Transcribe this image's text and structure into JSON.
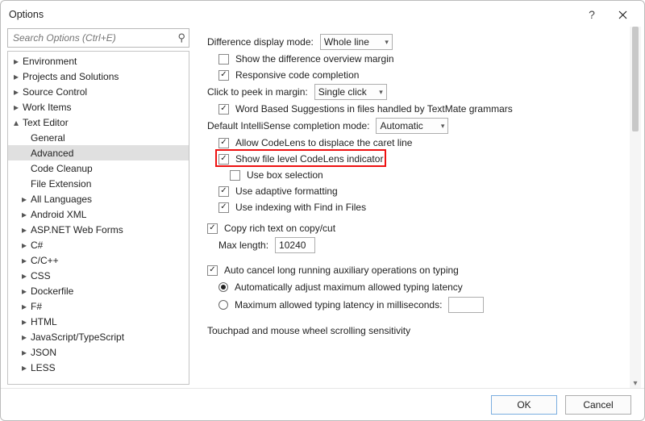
{
  "window": {
    "title": "Options"
  },
  "search": {
    "placeholder": "Search Options (Ctrl+E)"
  },
  "tree": {
    "items": [
      {
        "label": "Environment",
        "expandable": true,
        "expanded": false,
        "depth": 0
      },
      {
        "label": "Projects and Solutions",
        "expandable": true,
        "expanded": false,
        "depth": 0
      },
      {
        "label": "Source Control",
        "expandable": true,
        "expanded": false,
        "depth": 0
      },
      {
        "label": "Work Items",
        "expandable": true,
        "expanded": false,
        "depth": 0
      },
      {
        "label": "Text Editor",
        "expandable": true,
        "expanded": true,
        "depth": 0
      },
      {
        "label": "General",
        "expandable": false,
        "depth": 1
      },
      {
        "label": "Advanced",
        "expandable": false,
        "depth": 1,
        "selected": true
      },
      {
        "label": "Code Cleanup",
        "expandable": false,
        "depth": 1
      },
      {
        "label": "File Extension",
        "expandable": false,
        "depth": 1
      },
      {
        "label": "All Languages",
        "expandable": true,
        "expanded": false,
        "depth": 1
      },
      {
        "label": "Android XML",
        "expandable": true,
        "expanded": false,
        "depth": 1
      },
      {
        "label": "ASP.NET Web Forms",
        "expandable": true,
        "expanded": false,
        "depth": 1
      },
      {
        "label": "C#",
        "expandable": true,
        "expanded": false,
        "depth": 1
      },
      {
        "label": "C/C++",
        "expandable": true,
        "expanded": false,
        "depth": 1
      },
      {
        "label": "CSS",
        "expandable": true,
        "expanded": false,
        "depth": 1
      },
      {
        "label": "Dockerfile",
        "expandable": true,
        "expanded": false,
        "depth": 1
      },
      {
        "label": "F#",
        "expandable": true,
        "expanded": false,
        "depth": 1
      },
      {
        "label": "HTML",
        "expandable": true,
        "expanded": false,
        "depth": 1
      },
      {
        "label": "JavaScript/TypeScript",
        "expandable": true,
        "expanded": false,
        "depth": 1
      },
      {
        "label": "JSON",
        "expandable": true,
        "expanded": false,
        "depth": 1
      },
      {
        "label": "LESS",
        "expandable": true,
        "expanded": false,
        "depth": 1
      }
    ]
  },
  "settings": {
    "diff_mode_label": "Difference display mode:",
    "diff_mode_value": "Whole line",
    "show_diff_overview": {
      "label": "Show the difference overview margin",
      "checked": false
    },
    "responsive_completion": {
      "label": "Responsive code completion",
      "checked": true
    },
    "click_peek_label": "Click to peek in margin:",
    "click_peek_value": "Single click",
    "word_based": {
      "label": "Word Based Suggestions in files handled by TextMate grammars",
      "checked": true
    },
    "intellisense_label": "Default IntelliSense completion mode:",
    "intellisense_value": "Automatic",
    "allow_codelens": {
      "label": "Allow CodeLens to displace the caret line",
      "checked": true
    },
    "show_file_codelens": {
      "label": "Show file level CodeLens indicator",
      "checked": true
    },
    "use_box_selection": {
      "label": "Use box selection",
      "checked": false
    },
    "use_adaptive_fmt": {
      "label": "Use adaptive formatting",
      "checked": true
    },
    "use_indexing_fif": {
      "label": "Use indexing with Find in Files",
      "checked": true
    },
    "copy_rich_text": {
      "label": "Copy rich text on copy/cut",
      "checked": true
    },
    "max_length_label": "Max length:",
    "max_length_value": "10240",
    "auto_cancel": {
      "label": "Auto cancel long running auxiliary operations on typing",
      "checked": true
    },
    "radio_auto_adjust": {
      "label": "Automatically adjust maximum allowed typing latency",
      "checked": true
    },
    "radio_max_latency": {
      "label": "Maximum allowed typing latency in milliseconds:",
      "checked": false
    },
    "radio_max_latency_value": "",
    "touchpad_label": "Touchpad and mouse wheel scrolling sensitivity"
  },
  "buttons": {
    "ok": "OK",
    "cancel": "Cancel"
  }
}
